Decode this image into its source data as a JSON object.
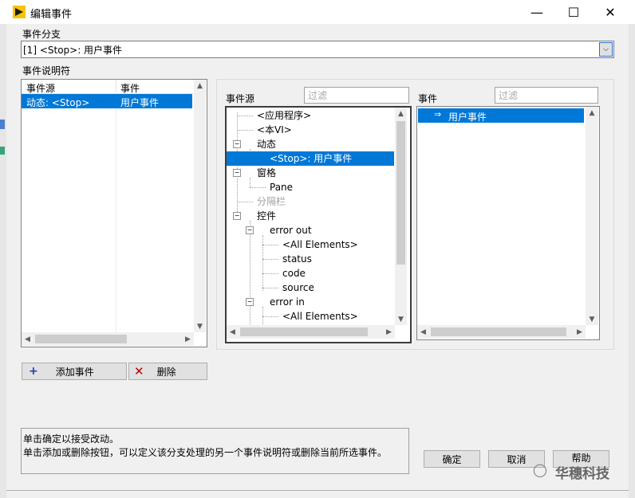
{
  "window": {
    "title": "编辑事件",
    "minimize_glyph": "—",
    "maximize_glyph": "☐",
    "close_glyph": "✕"
  },
  "event_case": {
    "label": "事件分支",
    "selected": "[1] <Stop>: 用户事件"
  },
  "specifiers": {
    "label": "事件说明符",
    "columns": [
      "事件源",
      "事件"
    ],
    "rows": [
      {
        "source": "动态: <Stop>",
        "event": "用户事件"
      }
    ]
  },
  "event_sources": {
    "label": "事件源",
    "filter_placeholder": "过滤",
    "items": [
      {
        "text": "<应用程序>",
        "grey": false
      },
      {
        "text": "<本VI>",
        "grey": false
      },
      {
        "text": "动态",
        "grey": false
      },
      {
        "text": "<Stop>: 用户事件",
        "grey": false
      },
      {
        "text": "窗格",
        "grey": false
      },
      {
        "text": "Pane",
        "grey": false
      },
      {
        "text": "分隔栏",
        "grey": true
      },
      {
        "text": "控件",
        "grey": false
      },
      {
        "text": "error out",
        "grey": false
      },
      {
        "text": "<All Elements>",
        "grey": false
      },
      {
        "text": "status",
        "grey": false
      },
      {
        "text": "code",
        "grey": false
      },
      {
        "text": "source",
        "grey": false
      },
      {
        "text": "error in",
        "grey": false
      },
      {
        "text": "<All Elements>",
        "grey": false
      }
    ]
  },
  "events": {
    "label": "事件",
    "filter_placeholder": "过滤",
    "items": [
      {
        "text": "用户事件"
      }
    ]
  },
  "buttons": {
    "add": "添加事件",
    "delete": "删除",
    "ok": "确定",
    "cancel": "取消",
    "help": "帮助"
  },
  "help_text": {
    "line1": "单击确定以接受改动。",
    "line2": "单击添加或删除按钮，可以定义该分支处理的另一个事件说明符或删除当前所选事件。"
  },
  "watermark": {
    "text": "华穗科技"
  },
  "colors": {
    "selection": "#0078d7",
    "title_icon": "#d9a300",
    "add_icon": "#1a3fb0",
    "delete_icon": "#c00000"
  }
}
